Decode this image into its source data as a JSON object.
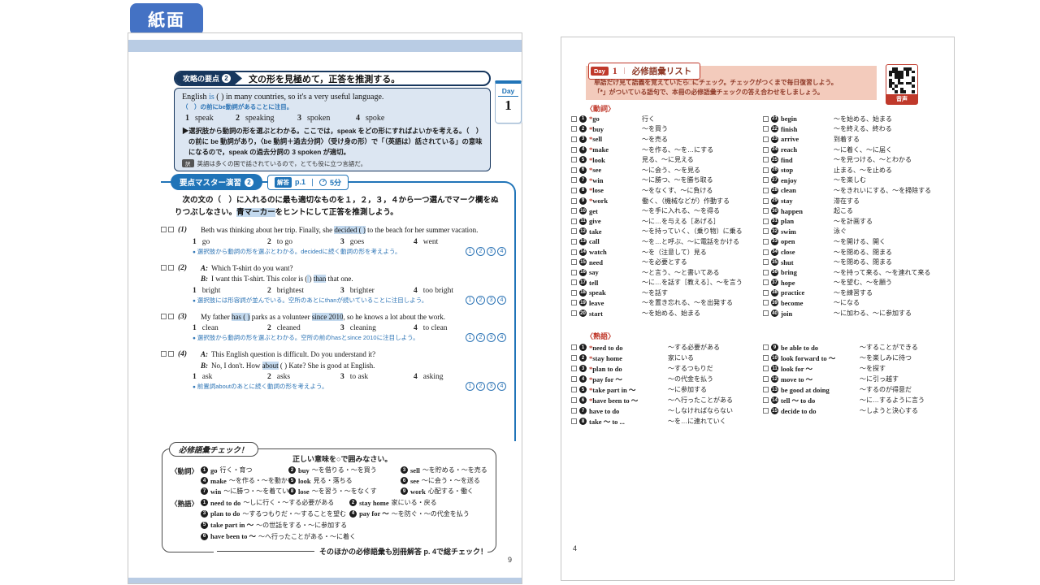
{
  "page_label": "紙面",
  "left_page": {
    "point_box": {
      "tag": "攻略の要点",
      "tag_num": "2",
      "title": "文の形を見極めて，正答を推測する。",
      "example_segments": [
        {
          "t": "English "
        },
        {
          "t": "is",
          "c": "blue"
        },
        {
          "t": " (        ) in many countries, so it's a very useful language."
        }
      ],
      "note": "（　）の前にbe動詞があることに注目。",
      "options": [
        "speak",
        "speaking",
        "spoken",
        "spoke"
      ],
      "explanation": "▶選択肢から動詞の形を選ぶとわかる。ここでは，speak をどの形にすればよいかを考える。（　）の前に be 動詞があり，〈be 動詞＋過去分詞〉（受け身の形）で「（英語は）話されている」の意味になるので，speak の過去分詞の 3 spoken が適切。",
      "translation_tag": "訳",
      "translation": "英語は多くの国で話されているので，とても役に立つ言語だ。"
    },
    "day_tab": {
      "label": "Day",
      "num": "1"
    },
    "exercise": {
      "tag": "要点マスター演習",
      "tag_num": "2",
      "answer_label": "解答",
      "answer_page": "p.1",
      "divider": "｜",
      "time": "5分",
      "instruction_segments": [
        {
          "t": "　次の文の（　）に入れるのに最も適切なものを１，２，３，４から一つ選んでマーク欄をぬりつぶしなさい。"
        },
        {
          "t": "青マーカー",
          "h": true
        },
        {
          "t": "をヒントにして正答を推測しよう。"
        }
      ],
      "mark_numbers": [
        "1",
        "2",
        "3",
        "4"
      ],
      "questions": [
        {
          "num": "(1)",
          "lines": [
            {
              "segs": [
                {
                  "t": "Beth was thinking about her trip.  Finally, she "
                },
                {
                  "t": "decided (      )",
                  "h": true
                },
                {
                  "t": " to the beach for her summer vacation."
                }
              ]
            }
          ],
          "options": [
            "go",
            "to go",
            "goes",
            "went"
          ],
          "hint": "選択肢から動詞の形を選ぶとわかる。decidedに続く動詞の形を考えよう。"
        },
        {
          "num": "(2)",
          "lines": [
            {
              "p": "A:",
              "segs": [
                {
                  "t": "Which T-shirt do you want?"
                }
              ]
            },
            {
              "p": "B:",
              "segs": [
                {
                  "t": "I want this T-shirt.  This color is ("
                },
                {
                  "t": "      ",
                  "h": true
                },
                {
                  "t": ") "
                },
                {
                  "t": "than",
                  "h": true
                },
                {
                  "t": " that one."
                }
              ]
            }
          ],
          "options": [
            "bright",
            "brightest",
            "brighter",
            "too bright"
          ],
          "hint": "選択肢には形容詞が並んでいる。空所のあとにthanが続いていることに注目しよう。"
        },
        {
          "num": "(3)",
          "lines": [
            {
              "segs": [
                {
                  "t": "My father "
                },
                {
                  "t": "has (      )",
                  "h": true
                },
                {
                  "t": " parks as a volunteer "
                },
                {
                  "t": "since 2010",
                  "h": true
                },
                {
                  "t": ", so he knows a lot about the work."
                }
              ]
            }
          ],
          "options": [
            "clean",
            "cleaned",
            "cleaning",
            "to clean"
          ],
          "hint": "選択肢から動詞の形を選ぶとわかる。空所の前のhasとsince 2010に注目しよう。"
        },
        {
          "num": "(4)",
          "lines": [
            {
              "p": "A:",
              "segs": [
                {
                  "t": "This English question is difficult.  Do you understand it?"
                }
              ]
            },
            {
              "p": "B:",
              "segs": [
                {
                  "t": "No, I don't.  How "
                },
                {
                  "t": "about",
                  "h": true
                },
                {
                  "t": " (      ) Kate?  She is good at English."
                }
              ]
            }
          ],
          "options": [
            "ask",
            "asks",
            "to ask",
            "asking"
          ],
          "hint": "前置詞aboutのあとに続く動詞の形を考えよう。"
        }
      ]
    },
    "vocab_check": {
      "title": "必修語彙チェック！",
      "subtitle": "正しい意味を○で囲みなさい。",
      "verbs_label": "〈動詞〉",
      "verbs": [
        {
          "n": "1",
          "w": "go",
          "m": "行く・育つ"
        },
        {
          "n": "2",
          "w": "buy",
          "m": "～を借りる・～を買う"
        },
        {
          "n": "3",
          "w": "sell",
          "m": "～を貯める・～を売る"
        },
        {
          "n": "4",
          "w": "make",
          "m": "～を作る・～を動かす"
        },
        {
          "n": "5",
          "w": "look",
          "m": "見る・落ちる"
        },
        {
          "n": "6",
          "w": "see",
          "m": "～に会う・～を送る"
        },
        {
          "n": "7",
          "w": "win",
          "m": "～に勝つ・～を着ている"
        },
        {
          "n": "8",
          "w": "lose",
          "m": "～を習う・～をなくす"
        },
        {
          "n": "9",
          "w": "work",
          "m": "心配する・働く"
        }
      ],
      "idioms_label": "〈熟語〉",
      "idioms": [
        {
          "n": "1",
          "w": "need to do",
          "m": "～しに行く・～する必要がある"
        },
        {
          "n": "2",
          "w": "stay home",
          "m": "家にいる・戻る"
        },
        {
          "n": "3",
          "w": "plan to do",
          "m": "～するつもりだ・～することを望む"
        },
        {
          "n": "4",
          "w": "pay for ～",
          "m": "～を防ぐ・～の代金を払う"
        },
        {
          "n": "5",
          "w": "take part in ～",
          "m": "～の世話をする・～に参加する"
        },
        {
          "n": "6",
          "w": "have been to ～",
          "m": "～へ行ったことがある・～に着く"
        }
      ],
      "footer": "そのほかの必修語彙も別冊解答 p. 4で総チェック！",
      "page_num": "9"
    }
  },
  "right_page": {
    "header": {
      "day_label": "Day",
      "day_num": "1",
      "divider": "｜",
      "title": "必修語彙リスト",
      "line1": "単語だけ見て語義を覚えていたら□にチェック。チェックがつくまで毎日復習しよう。",
      "line2": "「*」がついている語句で、本冊の必修語彙チェックの答え合わせをしましょう。",
      "audio_label": "音声"
    },
    "verbs_label": "〈動詞〉",
    "verbs": [
      {
        "n": "1",
        "s": true,
        "w": "go",
        "m": "行く"
      },
      {
        "n": "2",
        "s": true,
        "w": "buy",
        "m": "～を買う"
      },
      {
        "n": "3",
        "s": true,
        "w": "sell",
        "m": "～を売る"
      },
      {
        "n": "4",
        "s": true,
        "w": "make",
        "m": "～を作る、～を…にする"
      },
      {
        "n": "5",
        "s": true,
        "w": "look",
        "m": "見る、～に見える"
      },
      {
        "n": "6",
        "s": true,
        "w": "see",
        "m": "～に会う、～を見る"
      },
      {
        "n": "7",
        "s": true,
        "w": "win",
        "m": "～に勝つ、～を勝ち取る"
      },
      {
        "n": "8",
        "s": true,
        "w": "lose",
        "m": "～をなくす、～に負ける"
      },
      {
        "n": "9",
        "s": true,
        "w": "work",
        "m": "働く、（機械などが）作動する"
      },
      {
        "n": "10",
        "s": false,
        "w": "get",
        "m": "～を手に入れる、～を得る"
      },
      {
        "n": "11",
        "s": false,
        "w": "give",
        "m": "～に…を与える［あげる］"
      },
      {
        "n": "12",
        "s": false,
        "w": "take",
        "m": "～を持っていく、（乗り物）に乗る"
      },
      {
        "n": "13",
        "s": false,
        "w": "call",
        "m": "～を…と呼ぶ、～に電話をかける"
      },
      {
        "n": "14",
        "s": false,
        "w": "watch",
        "m": "～を（注意して）見る"
      },
      {
        "n": "15",
        "s": false,
        "w": "need",
        "m": "～を必要とする"
      },
      {
        "n": "16",
        "s": false,
        "w": "say",
        "m": "～と言う、～と書いてある"
      },
      {
        "n": "17",
        "s": false,
        "w": "tell",
        "m": "～に…を話す［教える］、～を言う"
      },
      {
        "n": "18",
        "s": false,
        "w": "speak",
        "m": "～を話す"
      },
      {
        "n": "19",
        "s": false,
        "w": "leave",
        "m": "～を置き忘れる、～を出発する"
      },
      {
        "n": "20",
        "s": false,
        "w": "start",
        "m": "～を始める、始まる"
      },
      {
        "n": "21",
        "s": false,
        "w": "begin",
        "m": "～を始める、始まる"
      },
      {
        "n": "22",
        "s": false,
        "w": "finish",
        "m": "～を終える、終わる"
      },
      {
        "n": "23",
        "s": false,
        "w": "arrive",
        "m": "到着する"
      },
      {
        "n": "24",
        "s": false,
        "w": "reach",
        "m": "～に着く、～に届く"
      },
      {
        "n": "25",
        "s": false,
        "w": "find",
        "m": "～を見つける、～とわかる"
      },
      {
        "n": "26",
        "s": false,
        "w": "stop",
        "m": "止まる、～を止める"
      },
      {
        "n": "27",
        "s": false,
        "w": "enjoy",
        "m": "～を楽しむ"
      },
      {
        "n": "28",
        "s": false,
        "w": "clean",
        "m": "～をきれいにする、～を掃除する"
      },
      {
        "n": "29",
        "s": false,
        "w": "stay",
        "m": "滞在する"
      },
      {
        "n": "30",
        "s": false,
        "w": "happen",
        "m": "起こる"
      },
      {
        "n": "31",
        "s": false,
        "w": "plan",
        "m": "～を計画する"
      },
      {
        "n": "32",
        "s": false,
        "w": "swim",
        "m": "泳ぐ"
      },
      {
        "n": "33",
        "s": false,
        "w": "open",
        "m": "～を開ける、開く"
      },
      {
        "n": "34",
        "s": false,
        "w": "close",
        "m": "～を閉める、閉まる"
      },
      {
        "n": "35",
        "s": false,
        "w": "shut",
        "m": "～を閉める、閉まる"
      },
      {
        "n": "36",
        "s": false,
        "w": "bring",
        "m": "～を持って来る、～を連れて来る"
      },
      {
        "n": "37",
        "s": false,
        "w": "hope",
        "m": "～を望む、～を願う"
      },
      {
        "n": "38",
        "s": false,
        "w": "practice",
        "m": "～を練習する"
      },
      {
        "n": "39",
        "s": false,
        "w": "become",
        "m": "～になる"
      },
      {
        "n": "40",
        "s": false,
        "w": "join",
        "m": "～に加わる、～に参加する"
      }
    ],
    "idioms_label": "〈熟語〉",
    "idioms": [
      {
        "n": "1",
        "s": true,
        "w": "need to do",
        "m": "～する必要がある"
      },
      {
        "n": "2",
        "s": true,
        "w": "stay home",
        "m": "家にいる"
      },
      {
        "n": "3",
        "s": true,
        "w": "plan to do",
        "m": "～するつもりだ"
      },
      {
        "n": "4",
        "s": true,
        "w": "pay for ～",
        "m": "～の代金を払う"
      },
      {
        "n": "5",
        "s": true,
        "w": "take part in ～",
        "m": "～に参加する"
      },
      {
        "n": "6",
        "s": true,
        "w": "have been to ～",
        "m": "～へ行ったことがある"
      },
      {
        "n": "7",
        "s": false,
        "w": "have to do",
        "m": "～しなければならない"
      },
      {
        "n": "8",
        "s": false,
        "w": "take ～ to ...",
        "m": "～を…に連れていく"
      },
      {
        "n": "9",
        "s": false,
        "w": "be able to do",
        "m": "～することができる"
      },
      {
        "n": "10",
        "s": false,
        "w": "look forward to ～",
        "m": "～を楽しみに待つ"
      },
      {
        "n": "11",
        "s": false,
        "w": "look for ～",
        "m": "～を探す"
      },
      {
        "n": "12",
        "s": false,
        "w": "move to ～",
        "m": "～に引っ越す"
      },
      {
        "n": "13",
        "s": false,
        "w": "be good at doing",
        "m": "～するのが得意だ"
      },
      {
        "n": "14",
        "s": false,
        "w": "tell ～ to do",
        "m": "～に…するように言う"
      },
      {
        "n": "15",
        "s": false,
        "w": "decide to do",
        "m": "～しようと決心する"
      }
    ],
    "page_num": "4"
  }
}
